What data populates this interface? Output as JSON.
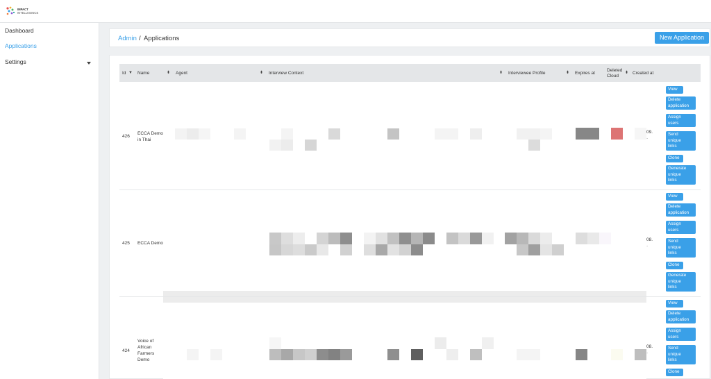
{
  "brand": {
    "logo_name": "impact-intelligence-logo",
    "lines": [
      "IMPACT",
      "INTELLIGENCE"
    ]
  },
  "sidebar": {
    "items": [
      {
        "label": "Dashboard"
      },
      {
        "label": "Applications",
        "active": true
      },
      {
        "label": "Settings"
      }
    ]
  },
  "breadcrumb": {
    "root": "Admin",
    "separator": "/",
    "current": "Applications"
  },
  "actions": {
    "new_application": "New Application"
  },
  "table": {
    "columns": [
      "Id",
      "Name",
      "Agent",
      "Interview Context",
      "Interviewee Profile",
      "Expires at",
      "Deleted Cloud",
      "Created at"
    ],
    "deleted_line1": "Deleted",
    "deleted_line2": "Cloud",
    "rows": [
      {
        "id": "426",
        "name_lines": [
          "ECCA Demo",
          "in Thai"
        ],
        "created": "09.",
        "created2": "·"
      },
      {
        "id": "425",
        "name_lines": [
          "ECCA Demo"
        ],
        "created": "08.",
        "created2": "·"
      },
      {
        "id": "424",
        "name_lines": [
          "Voice of",
          "African",
          "Farmers",
          "Demo"
        ],
        "created": "08.",
        "created2": "·"
      }
    ],
    "row_actions": {
      "view": "View",
      "delete": [
        "Delete",
        "application"
      ],
      "assign": [
        "Assign",
        "users"
      ],
      "send": [
        "Send",
        "unique",
        "links"
      ],
      "clone": "Clone",
      "generate": [
        "Generate",
        "unique",
        "links"
      ]
    }
  },
  "colors": {
    "accent": "#3aa0e8",
    "expired_red": "#dd7474"
  }
}
